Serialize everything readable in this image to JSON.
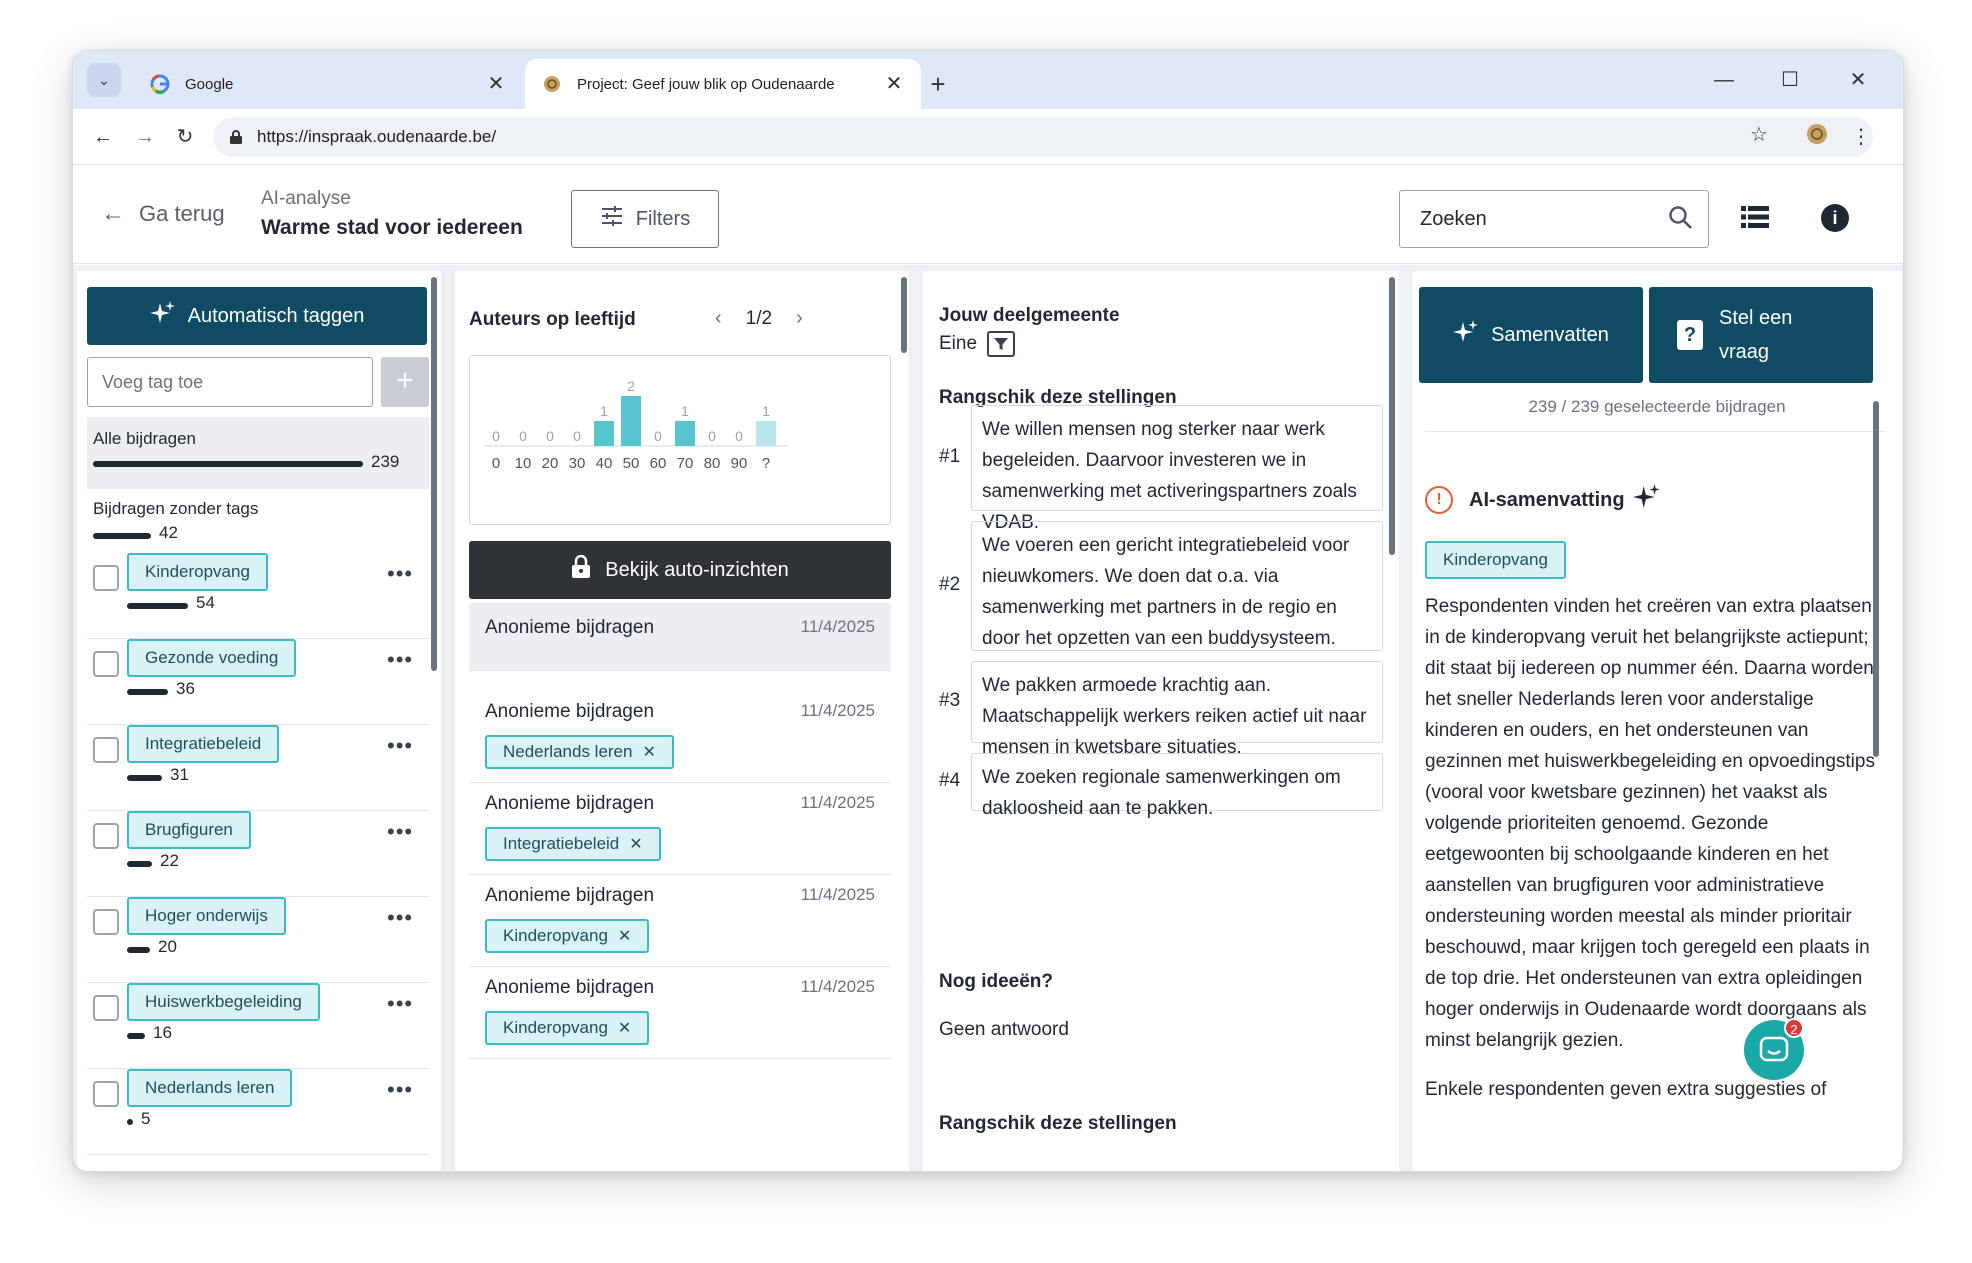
{
  "browser": {
    "tabs": [
      {
        "title": "Google"
      },
      {
        "title": "Project: Geef jouw blik op Oudenaarde"
      }
    ],
    "url": "https://inspraak.oudenaarde.be/"
  },
  "header": {
    "back_label": "Ga terug",
    "subtitle": "AI-analyse",
    "title": "Warme stad voor iedereen",
    "filters_label": "Filters",
    "search_placeholder": "Zoeken"
  },
  "tags_panel": {
    "auto_tag_label": "Automatisch taggen",
    "add_tag_placeholder": "Voeg tag toe",
    "all_label": "Alle bijdragen",
    "all_count": "239",
    "untagged_label": "Bijdragen zonder tags",
    "untagged_count": "42",
    "tags": [
      {
        "name": "Kinderopvang",
        "count": "54",
        "fraction": 0.226
      },
      {
        "name": "Gezonde voeding",
        "count": "36",
        "fraction": 0.151
      },
      {
        "name": "Integratiebeleid",
        "count": "31",
        "fraction": 0.13
      },
      {
        "name": "Brugfiguren",
        "count": "22",
        "fraction": 0.092
      },
      {
        "name": "Hoger onderwijs",
        "count": "20",
        "fraction": 0.084
      },
      {
        "name": "Huiswerkbegeleiding",
        "count": "16",
        "fraction": 0.067
      },
      {
        "name": "Nederlands leren",
        "count": "5",
        "fraction": 0.021
      }
    ]
  },
  "insights_panel": {
    "chart_title": "Auteurs op leeftijd",
    "page": "1/2",
    "insights_label": "Bekijk auto-inzichten",
    "contributions": [
      {
        "title": "Anonieme bijdragen",
        "date": "11/4/2025",
        "tag": ""
      },
      {
        "title": "Anonieme bijdragen",
        "date": "11/4/2025",
        "tag": "Nederlands leren"
      },
      {
        "title": "Anonieme bijdragen",
        "date": "11/4/2025",
        "tag": "Integratiebeleid"
      },
      {
        "title": "Anonieme bijdragen",
        "date": "11/4/2025",
        "tag": "Kinderopvang"
      },
      {
        "title": "Anonieme bijdragen",
        "date": "11/4/2025",
        "tag": "Kinderopvang"
      }
    ]
  },
  "chart_data": {
    "type": "bar",
    "title": "Auteurs op leeftijd",
    "categories": [
      "0",
      "10",
      "20",
      "30",
      "40",
      "50",
      "60",
      "70",
      "80",
      "90",
      "?"
    ],
    "values": [
      0,
      0,
      0,
      0,
      1,
      2,
      0,
      1,
      0,
      0,
      1
    ],
    "ylim": [
      0,
      2
    ],
    "colors": {
      "main": "#57c4cf",
      "unknown": "#b8e6ec"
    }
  },
  "response_panel": {
    "district_heading": "Jouw deelgemeente",
    "district_value": "Eine",
    "rank_heading": "Rangschik deze stellingen",
    "statements": [
      {
        "num": "#1",
        "text": "We willen mensen nog sterker naar werk begeleiden. Daarvoor investeren we in samenwerking met activeringspartners zoals VDAB."
      },
      {
        "num": "#2",
        "text": "We voeren een gericht integratiebeleid voor nieuwkomers. We doen dat o.a. via samenwerking met partners in de regio en door het opzetten van een buddysysteem."
      },
      {
        "num": "#3",
        "text": "We pakken armoede krachtig aan. Maatschappelijk werkers reiken actief uit naar mensen in kwetsbare situaties."
      },
      {
        "num": "#4",
        "text": "We zoeken regionale samenwerkingen om dakloosheid aan te pakken."
      }
    ],
    "ideas_heading": "Nog ideeën?",
    "ideas_value": "Geen antwoord",
    "rank_heading_2": "Rangschik deze stellingen"
  },
  "summary_panel": {
    "summarize_label": "Samenvatten",
    "ask_label": "Stel een vraag",
    "selected_count": "239 / 239 geselecteerde bijdragen",
    "summary_heading": "AI-samenvatting",
    "tag": "Kinderopvang",
    "text": "Respondenten vinden het creëren van extra plaatsen in de kinderopvang veruit het belangrijkste actiepunt; dit staat bij iedereen op nummer één. Daarna worden het sneller Nederlands leren voor anderstalige kinderen en ouders, en het ondersteunen van gezinnen met huiswerkbegeleiding en opvoedingstips (vooral voor kwetsbare gezinnen) het vaakst als volgende prioriteiten genoemd. Gezonde eetgewoonten bij schoolgaande kinderen en het aanstellen van brugfiguren voor administratieve ondersteuning worden meestal als minder prioritair beschouwd, maar krijgen toch geregeld een plaats in de top drie. Het ondersteunen van extra opleidingen hoger onderwijs in Oudenaarde wordt doorgaans als minst belangrijk gezien.",
    "text_more": "Enkele respondenten geven extra suggesties of",
    "chat_badge": "2"
  },
  "colors": {
    "primary": "#0f4c63",
    "tag_bg": "#d9f2f5",
    "tag_border": "#3bbac7",
    "warning": "#e0603a"
  }
}
